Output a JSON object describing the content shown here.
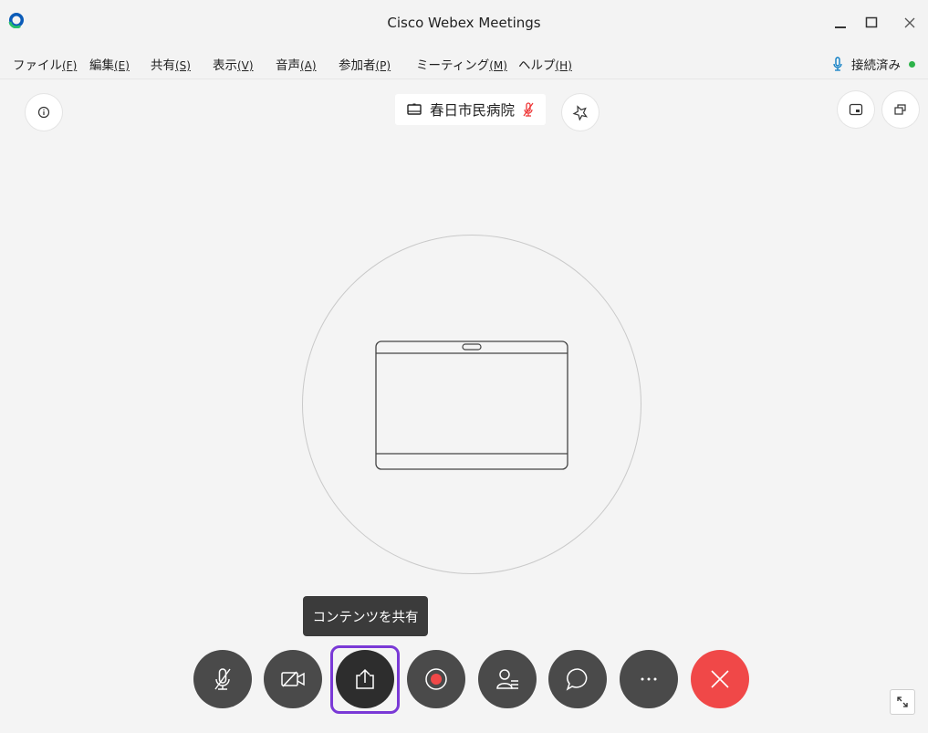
{
  "window": {
    "title": "Cisco Webex Meetings"
  },
  "menu": [
    {
      "label": "ファイル",
      "accel": "(F)"
    },
    {
      "label": "編集",
      "accel": "(E)"
    },
    {
      "label": "共有",
      "accel": "(S)"
    },
    {
      "label": "表示",
      "accel": "(V)"
    },
    {
      "label": "音声",
      "accel": "(A)"
    },
    {
      "label": "参加者",
      "accel": "(P)"
    },
    {
      "label": "ミーティング",
      "accel": "(M)"
    },
    {
      "label": "ヘルプ",
      "accel": "(H)"
    }
  ],
  "status": {
    "label": "接続済み",
    "color": "#2eb34a"
  },
  "room": {
    "name": "春日市民病院"
  },
  "tooltip": {
    "text": "コンテンツを共有"
  },
  "controls": {
    "mute": "mic-muted-icon",
    "video": "video-off-icon",
    "share": "share-icon",
    "record": "record-icon",
    "participants": "participants-icon",
    "chat": "chat-icon",
    "more": "more-icon",
    "end": "end-call-icon"
  },
  "colors": {
    "accent_focus": "#7a39d6",
    "end_call": "#f04848",
    "control_bg": "#4a4a4a",
    "record_dot": "#f04848"
  }
}
